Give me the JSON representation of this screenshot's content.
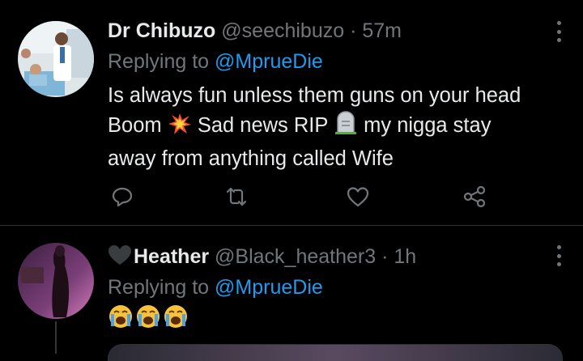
{
  "tweets": [
    {
      "name": "Dr Chibuzo",
      "handle": "@seechibuzo",
      "separator": "·",
      "time": "57m",
      "replying_prefix": "Replying to",
      "replying_to": "@MprueDie",
      "text_line1": "Is always fun unless them guns on your head",
      "text_line2a": "Boom",
      "text_line2b": "Sad news RIP",
      "text_line2c": "my nigga stay",
      "text_line3": "away from anything called Wife",
      "emojis": [
        "collision-emoji",
        "headstone-emoji"
      ]
    },
    {
      "name": "Heather",
      "handle": "@Black_heather3",
      "separator": "·",
      "time": "1h",
      "replying_prefix": "Replying to",
      "replying_to": "@MprueDie",
      "emojis": [
        "loudly-crying-face-emoji",
        "loudly-crying-face-emoji",
        "loudly-crying-face-emoji"
      ]
    }
  ],
  "icons": [
    "reply-icon",
    "retweet-icon",
    "like-icon",
    "share-icon",
    "more-icon",
    "black-heart-emoji"
  ],
  "colors": {
    "background": "#000000",
    "text": "#e7e9ea",
    "muted": "#71767b",
    "link": "#1d9bf0",
    "divider": "#2f3336"
  }
}
